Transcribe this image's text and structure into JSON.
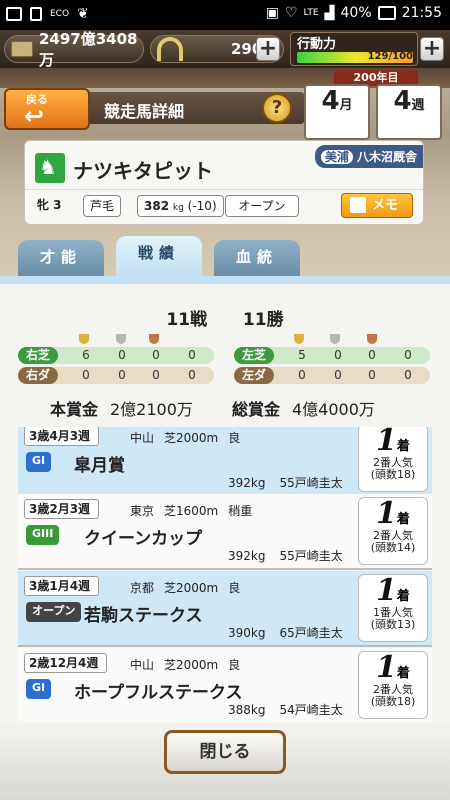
{
  "status_bar": {
    "eco": "ECO",
    "lte": "LTE",
    "battery": "40%",
    "time": "21:55"
  },
  "resources": {
    "money": "2497億3408万",
    "horseshoe": "290",
    "stamina_label": "行動力",
    "stamina_value": "129/100",
    "stamina_fraction": 1.0
  },
  "calendar": {
    "year": "200年目",
    "month": "4",
    "month_unit": "月",
    "week": "4",
    "week_unit": "週"
  },
  "header": {
    "back_label": "戻る",
    "title": "競走馬詳細",
    "help": "?"
  },
  "horse": {
    "name": "ナツキタピット",
    "stable_region": "美浦",
    "trainer": "八木沼厩舎",
    "sex_age": "牝 3",
    "coat": "芦毛",
    "weight": "382",
    "weight_unit": "kg",
    "weight_change": "(-10)",
    "class": "オープン",
    "memo_label": "メモ"
  },
  "tabs": [
    {
      "label": "才能"
    },
    {
      "label": "戦績"
    },
    {
      "label": "血統"
    }
  ],
  "record": {
    "starts": "11戦",
    "wins": "11勝"
  },
  "stats": {
    "turf_right": {
      "label": "右芝",
      "vals": [
        "6",
        "0",
        "0",
        "0"
      ]
    },
    "dirt_right": {
      "label": "右ダ",
      "vals": [
        "0",
        "0",
        "0",
        "0"
      ]
    },
    "turf_left": {
      "label": "左芝",
      "vals": [
        "5",
        "0",
        "0",
        "0"
      ]
    },
    "dirt_left": {
      "label": "左ダ",
      "vals": [
        "0",
        "0",
        "0",
        "0"
      ]
    }
  },
  "prize": {
    "main_label": "本賞金",
    "main_value": "2億2100万",
    "total_label": "総賞金",
    "total_value": "4億4000万"
  },
  "races": [
    {
      "date": "3歳4月3週",
      "track": "中山",
      "course": "芝2000m",
      "cond": "良",
      "grade": "GI",
      "grade_color": "#2a6fd1",
      "name": "皐月賞",
      "body_weight": "392kg",
      "jockey": "55戸崎圭太",
      "place": "1",
      "place_unit": "着",
      "pop": "2番人気",
      "heads": "(頭数18)",
      "bg": "blue"
    },
    {
      "date": "3歳2月3週",
      "track": "東京",
      "course": "芝1600m",
      "cond": "稍重",
      "grade": "GIII",
      "grade_color": "#3a9a3a",
      "name": "クイーンカップ",
      "body_weight": "392kg",
      "jockey": "55戸崎圭太",
      "place": "1",
      "place_unit": "着",
      "pop": "2番人気",
      "heads": "(頭数14)",
      "bg": "white"
    },
    {
      "date": "3歳1月4週",
      "track": "京都",
      "course": "芝2000m",
      "cond": "良",
      "grade": "オープン",
      "grade_color": "#444444",
      "name": "若駒ステークス",
      "body_weight": "390kg",
      "jockey": "65戸崎圭太",
      "place": "1",
      "place_unit": "着",
      "pop": "1番人気",
      "heads": "(頭数13)",
      "bg": "blue"
    },
    {
      "date": "2歳12月4週",
      "track": "中山",
      "course": "芝2000m",
      "cond": "良",
      "grade": "GI",
      "grade_color": "#2a6fd1",
      "name": "ホープフルステークス",
      "body_weight": "388kg",
      "jockey": "54戸崎圭太",
      "place": "1",
      "place_unit": "着",
      "pop": "2番人気",
      "heads": "(頭数18)",
      "bg": "white"
    }
  ],
  "footer": {
    "close_label": "閉じる"
  }
}
